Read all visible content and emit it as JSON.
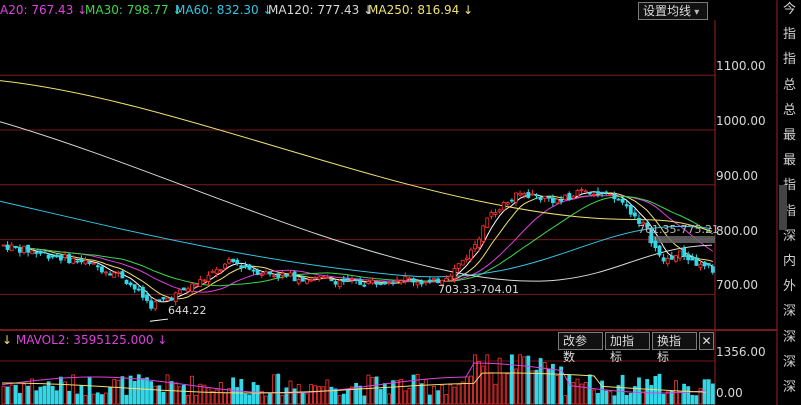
{
  "ma_legend": {
    "ma20": {
      "label": "A20: 767.43",
      "arrow": "↓",
      "color": "#e040e0"
    },
    "ma30": {
      "label": "MA30: 798.77",
      "arrow": "↓",
      "color": "#3cd84a"
    },
    "ma60": {
      "label": "MA60: 832.30",
      "arrow": "↓",
      "color": "#33c6e6"
    },
    "ma120": {
      "label": "MA120: 777.43",
      "arrow": "↓",
      "color": "#d8d8d8"
    },
    "ma250": {
      "label": "MA250: 816.94",
      "arrow": "↓",
      "color": "#f0e070"
    }
  },
  "settings_button": "设置均线",
  "price_axis": [
    "1100.00",
    "1000.00",
    "900.00",
    "800.00",
    "700.00"
  ],
  "price_annotations": {
    "low": "644.22",
    "range_low": "703.33-704.01",
    "range_high": "761.35-775.21"
  },
  "volume": {
    "label": "MAVOL2: 3595125.000",
    "arrow": "↓",
    "axis": [
      "1356.00",
      "0.00"
    ],
    "buttons": [
      "改参数",
      "加指标",
      "换指标"
    ],
    "close_icon": "✕"
  },
  "sidebar_items": [
    "今",
    "指",
    "指",
    "总",
    "总",
    "最",
    "最",
    "指",
    "指",
    "深",
    "内",
    "外",
    "深",
    "深",
    "深",
    "深"
  ],
  "colors": {
    "up": "#ff3333",
    "down": "#33d8e8",
    "ma20": "#e040e0",
    "ma30": "#3cd84a",
    "ma60": "#33c6e6",
    "ma120": "#d8d8d8",
    "ma250": "#f0e070",
    "grid": "#7a1a1a"
  }
}
